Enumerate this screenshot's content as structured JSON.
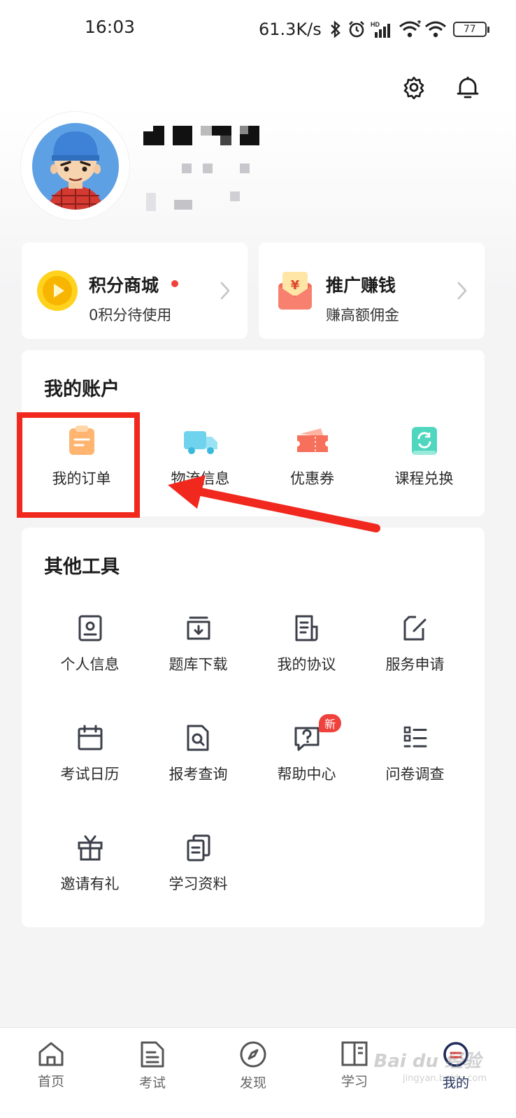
{
  "status_bar": {
    "time": "16:03",
    "net_speed": "61.3K/s",
    "battery": "77",
    "icons": [
      "bluetooth-icon",
      "alarm-icon",
      "hd-signal-icon",
      "wifi-icon",
      "wifi-icon",
      "battery-icon"
    ]
  },
  "header": {
    "icons": [
      "settings-icon",
      "bell-icon"
    ]
  },
  "profile": {
    "avatar": "cartoon-boy-avatar"
  },
  "promo_cards": [
    {
      "title": "积分商城",
      "subtitle": "0积分待使用",
      "icon": "points-play-icon",
      "badge_color": "#f0413c"
    },
    {
      "title": "推广赚钱",
      "subtitle": "赚高额佣金",
      "icon": "red-envelope-yen-icon"
    }
  ],
  "account": {
    "title": "我的账户",
    "items": [
      {
        "label": "我的订单",
        "icon": "order-clipboard-icon"
      },
      {
        "label": "物流信息",
        "icon": "delivery-truck-icon"
      },
      {
        "label": "优惠券",
        "icon": "coupon-icon"
      },
      {
        "label": "课程兑换",
        "icon": "course-exchange-icon"
      }
    ]
  },
  "tools": {
    "title": "其他工具",
    "items": [
      {
        "label": "个人信息",
        "icon": "id-card-icon"
      },
      {
        "label": "题库下载",
        "icon": "download-box-icon"
      },
      {
        "label": "我的协议",
        "icon": "agreement-doc-icon"
      },
      {
        "label": "服务申请",
        "icon": "edit-form-icon"
      },
      {
        "label": "考试日历",
        "icon": "calendar-icon"
      },
      {
        "label": "报考查询",
        "icon": "search-doc-icon"
      },
      {
        "label": "帮助中心",
        "icon": "help-chat-icon",
        "badge": "新"
      },
      {
        "label": "问卷调查",
        "icon": "survey-list-icon"
      },
      {
        "label": "邀请有礼",
        "icon": "gift-icon"
      },
      {
        "label": "学习资料",
        "icon": "documents-icon"
      }
    ]
  },
  "bottom_nav": [
    {
      "label": "首页",
      "icon": "home-icon"
    },
    {
      "label": "考试",
      "icon": "exam-doc-icon"
    },
    {
      "label": "发现",
      "icon": "compass-icon"
    },
    {
      "label": "学习",
      "icon": "book-icon"
    },
    {
      "label": "我的",
      "icon": "profile-icon",
      "active": true
    }
  ],
  "watermark": {
    "text": "Bai du 经验",
    "sub": "jingyan.baidu.com"
  },
  "colors": {
    "accent": "#1d2b5a",
    "annotation_red": "#f0281e",
    "badge_red": "#f0413c"
  }
}
